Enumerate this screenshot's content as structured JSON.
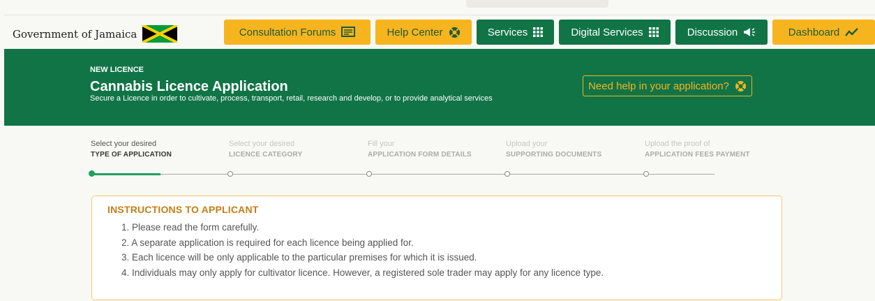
{
  "header": {
    "brand": "Government of Jamaica",
    "flag_icon": "jamaica-flag-icon",
    "nav": [
      {
        "label": "Consultation Forums",
        "icon": "forum-icon",
        "style": "yellow"
      },
      {
        "label": "Help Center",
        "icon": "lifebuoy-icon",
        "style": "yellow"
      },
      {
        "label": "Services",
        "icon": "grid-icon",
        "style": "green"
      },
      {
        "label": "Digital Services",
        "icon": "grid-icon",
        "style": "green"
      },
      {
        "label": "Discussion",
        "icon": "megaphone-icon",
        "style": "green"
      },
      {
        "label": "Dashboard",
        "icon": "trend-icon",
        "style": "yellow"
      }
    ]
  },
  "banner": {
    "eyebrow": "NEW LICENCE",
    "title": "Cannabis Licence Application",
    "subtitle": "Secure a Licence in order to cultivate, process, transport, retail, research and develop, or to provide analytical services",
    "help_button": "Need help in your application?"
  },
  "steps": [
    {
      "small": "Select your desired",
      "big": "TYPE OF APPLICATION",
      "active": true
    },
    {
      "small": "Select your desired",
      "big": "LICENCE CATEGORY",
      "active": false
    },
    {
      "small": "Fill your",
      "big": "APPLICATION FORM DETAILS",
      "active": false
    },
    {
      "small": "Upload your",
      "big": "SUPPORTING DOCUMENTS",
      "active": false
    },
    {
      "small": "Upload the proof of",
      "big": "APPLICATION FEES PAYMENT",
      "active": false
    }
  ],
  "instructions": {
    "heading": "INSTRUCTIONS TO APPLICANT",
    "items": [
      "1. Please read the form carefully.",
      "2. A separate application is required for each licence being applied for.",
      "3. Each licence will be only applicable to the particular premises for which it is issued.",
      "4. Individuals may only apply for cultivator licence. However, a registered sole trader may apply for any licence type."
    ]
  },
  "colors": {
    "brand_green": "#107447",
    "brand_yellow": "#f6b41e",
    "step_active": "#21a060",
    "instruction_heading": "#c47f14"
  }
}
